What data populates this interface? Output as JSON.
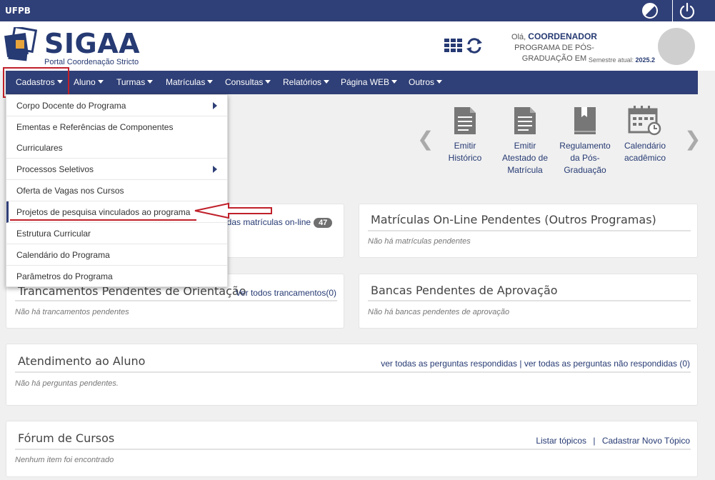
{
  "topbar": {
    "brand": "UFPB"
  },
  "header": {
    "logo_text": "SIGAA",
    "logo_sub": "Portal Coordenação Stricto",
    "greet_prefix": "Olá,",
    "user_role": "COORDENADOR",
    "program": "PROGRAMA DE PÓS-GRADUAÇÃO EM",
    "semester_label": "Semestre atual:",
    "semester_value": "2025.2"
  },
  "nav": {
    "items": [
      "Cadastros",
      "Aluno",
      "Turmas",
      "Matrículas",
      "Consultas",
      "Relatórios",
      "Página WEB",
      "Outros"
    ]
  },
  "dropdown": {
    "items": [
      "Corpo Docente do Programa",
      "Ementas e Referências de Componentes",
      "Curriculares",
      "Processos Seletivos",
      "Oferta de Vagas nos Cursos",
      "Projetos de pesquisa vinculados ao programa",
      "Estrutura Curricular",
      "Calendário do Programa",
      "Parâmetros do Programa"
    ]
  },
  "shortcuts": [
    {
      "line1": "Emitir",
      "line2": "Histórico",
      "line3": "",
      "icon": "document-icon"
    },
    {
      "line1": "Emitir",
      "line2": "Atestado de",
      "line3": "Matrícula",
      "icon": "document-icon"
    },
    {
      "line1": "Regulamento",
      "line2": "da Pós-",
      "line3": "Graduação",
      "icon": "book-icon"
    },
    {
      "line1": "Calendário",
      "line2": "acadêmico",
      "line3": "",
      "icon": "calendar-icon"
    }
  ],
  "panels": {
    "matriculas": {
      "link": "odas matrículas on-line",
      "badge": "47"
    },
    "outros": {
      "title": "Matrículas On-Line Pendentes (Outros Programas)",
      "empty": "Não há matrículas pendentes"
    },
    "trancamentos": {
      "title": "Trancamentos Pendentes de Orientação",
      "link": "Ver todos trancamentos(0)",
      "empty": "Não há trancamentos pendentes"
    },
    "bancas": {
      "title": "Bancas Pendentes de Aprovação",
      "empty": "Não há bancas pendentes de aprovação"
    },
    "atendimento": {
      "title": "Atendimento ao Aluno",
      "link1": "ver todas as perguntas respondidas",
      "sep": "|",
      "link2": "ver todas as perguntas não respondidas (0)",
      "empty": "Não há perguntas pendentes."
    },
    "forum": {
      "title": "Fórum de Cursos",
      "link1": "Listar tópicos",
      "sep": "|",
      "link2": "Cadastrar Novo Tópico",
      "empty": "Nenhum item foi encontrado"
    }
  },
  "colors": {
    "brand": "#2f3f77",
    "highlight": "#c0202a"
  }
}
